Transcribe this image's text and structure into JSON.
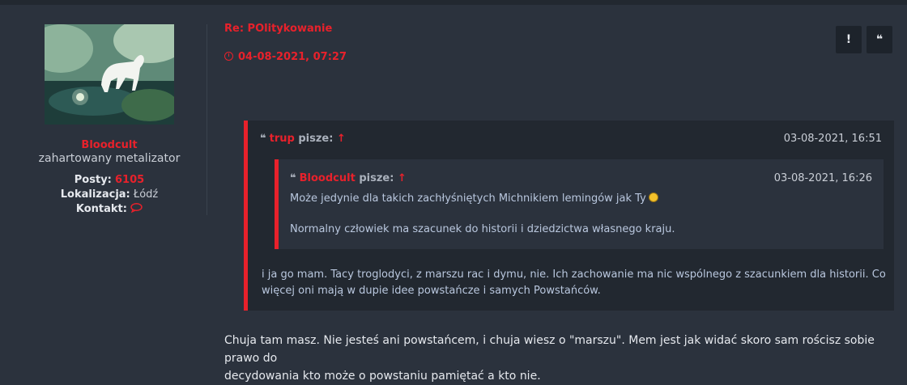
{
  "author": {
    "username": "Bloodcult",
    "rank": "zahartowany metalizator",
    "posts_label": "Posty:",
    "posts_value": "6105",
    "location_label": "Lokalizacja:",
    "location_value": "Łódź",
    "contact_label": "Kontakt:",
    "contact_icon": "chat-bubble-icon"
  },
  "post": {
    "title": "Re: POlitykowanie",
    "date": "04-08-2021, 07:27",
    "report_button": "!",
    "quote_button": "❝"
  },
  "outer_quote": {
    "author": "trup",
    "pisze": "pisze:",
    "arrow": "↑",
    "date": "03-08-2021, 16:51",
    "text_line1": "i ja go mam. Tacy troglodyci, z marszu rac i dymu, nie. Ich zachowanie ma nic wspólnego z szacunkiem dla historii. Co",
    "text_line2": "więcej oni mają w dupie idee powstańcze i samych Powstańców."
  },
  "inner_quote": {
    "author": "Bloodcult",
    "pisze": "pisze:",
    "arrow": "↑",
    "date": "03-08-2021, 16:26",
    "text_line1": "Może jedynie dla takich zachłyśniętych Michnikiem lemingów jak Ty",
    "text_line2": "Normalny człowiek ma szacunek do historii i dziedzictwa własnego kraju."
  },
  "reply": {
    "line1": "Chuja tam masz. Nie jesteś ani powstańcem, i chuja wiesz o \"marszu\". Mem jest jak widać skoro sam rościsz sobie prawo do",
    "line2": "decydowania kto może o powstaniu pamiętać a kto nie."
  },
  "colors": {
    "accent": "#e8212b",
    "background": "#2b323d",
    "quote_bg": "#222830"
  }
}
